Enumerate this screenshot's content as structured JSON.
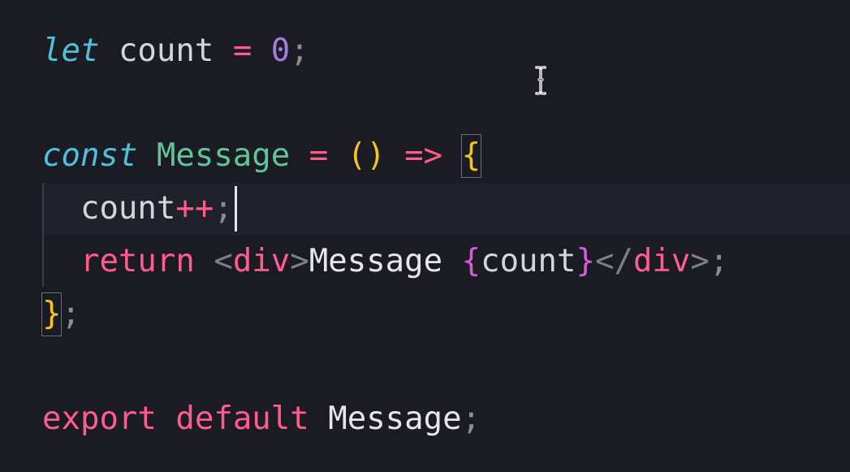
{
  "editor": {
    "line1": {
      "keyword": "let",
      "name": "count",
      "op": "=",
      "value": "0",
      "semi": ";"
    },
    "line3": {
      "keyword": "const",
      "name": "Message",
      "op": "=",
      "parens": "()",
      "arrow": "=>",
      "brace": "{"
    },
    "line4": {
      "name": "count",
      "op": "++",
      "semi": ";"
    },
    "line5": {
      "keyword": "return",
      "open_lt": "<",
      "open_tag": "div",
      "open_gt": ">",
      "text": "Message ",
      "brace_open": "{",
      "expr": "count",
      "brace_close": "}",
      "close_lt": "</",
      "close_tag": "div",
      "close_gt": ">",
      "semi": ";"
    },
    "line6": {
      "brace": "}",
      "semi": ";"
    },
    "line8": {
      "kw1": "export",
      "kw2": "default",
      "name": "Message",
      "semi": ";"
    }
  },
  "colors": {
    "background": "#1a1b23",
    "keyword_pink": "#ff5c8d",
    "storage_cyan": "#4fc0d8",
    "function_green": "#5fc496",
    "number_purple": "#a47ddb",
    "bracket_yellow": "#f5c518",
    "jsx_brace_magenta": "#d85ad8"
  },
  "icons": {
    "mouse": "text-cursor-icon"
  }
}
